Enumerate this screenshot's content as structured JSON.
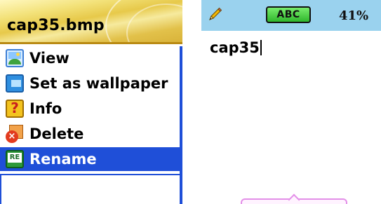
{
  "left_screen": {
    "title": "cap35.bmp",
    "menu_items": [
      {
        "label": "View",
        "icon": "image-view-icon",
        "selected": false
      },
      {
        "label": "Set as wallpaper",
        "icon": "wallpaper-icon",
        "selected": false
      },
      {
        "label": "Info",
        "icon": "info-question-icon",
        "selected": false
      },
      {
        "label": "Delete",
        "icon": "delete-icon",
        "selected": false
      },
      {
        "label": "Rename",
        "icon": "rename-icon",
        "selected": true
      }
    ],
    "colors": {
      "selection": "#1f4fd8",
      "title_bg": "#e7c94a"
    }
  },
  "right_screen": {
    "status": {
      "input_mode": "ABC",
      "battery": "41%",
      "edit_icon": "pencil-icon"
    },
    "text_field_value": "cap35",
    "colors": {
      "status_bg": "#9ad2ee",
      "mode_badge": "#3fc63a"
    }
  }
}
